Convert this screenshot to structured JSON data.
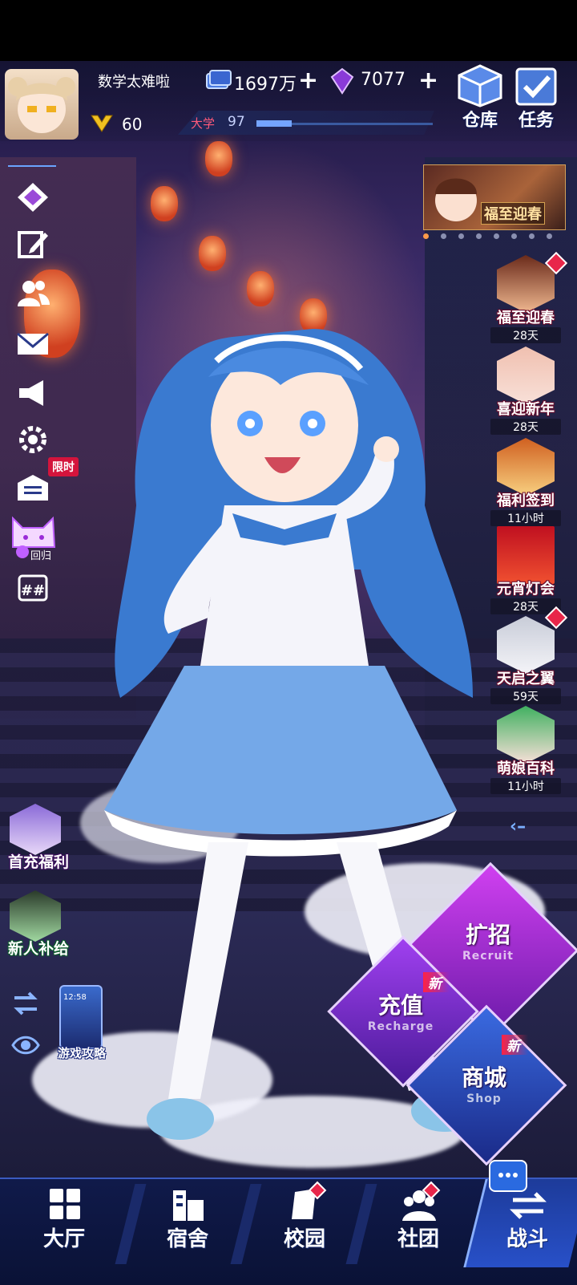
{
  "player": {
    "name": "数学太难啦",
    "level": "60",
    "school_label": "大学",
    "school_level": "97",
    "school_progress": 0.2
  },
  "resources": {
    "coins": "1697万",
    "gems": "7077"
  },
  "top_buttons": {
    "warehouse": "仓库",
    "tasks": "任务"
  },
  "left_menu": {
    "icons": [
      "diamond-icon",
      "edit-icon",
      "friends-icon",
      "mail-icon",
      "announcement-icon",
      "settings-icon",
      "limited-mail-icon",
      "return-cat-icon",
      "calendar-icon"
    ],
    "limited_tag": "限时",
    "return_label": "回归"
  },
  "banner": {
    "title": "福至迎春",
    "dot_count": 8
  },
  "right_events": [
    {
      "name": "福至迎春",
      "time": "28天",
      "badge": true
    },
    {
      "name": "喜迎新年",
      "time": "28天",
      "badge": false
    },
    {
      "name": "福利签到",
      "time": "11小时",
      "badge": false
    },
    {
      "name": "元宵灯会",
      "time": "28天",
      "badge": false
    },
    {
      "name": "天启之翼",
      "time": "59天",
      "badge": true
    },
    {
      "name": "萌娘百科",
      "time": "11小时",
      "badge": false
    }
  ],
  "left_events": [
    {
      "name": "首充福利"
    },
    {
      "name": "新人补给"
    }
  ],
  "guide": {
    "label": "游戏攻略",
    "phone_time": "12:58"
  },
  "action_buttons": {
    "recruit": {
      "cn": "扩招",
      "en": "Recruit"
    },
    "recharge": {
      "cn": "充值",
      "en": "Recharge",
      "new_tag": "新"
    },
    "shop": {
      "cn": "商城",
      "en": "Shop",
      "new_tag": "新"
    }
  },
  "bottom_nav": {
    "lobby": "大厅",
    "dorm": "宿舍",
    "campus": "校园",
    "club": "社团",
    "battle": "战斗"
  },
  "colors": {
    "accent_blue": "#3a5ac0",
    "badge_red": "#e8264a",
    "recruit_purple": "#b02ad8",
    "recharge_violet": "#7a2ad8",
    "shop_blue": "#2a4ab8"
  }
}
